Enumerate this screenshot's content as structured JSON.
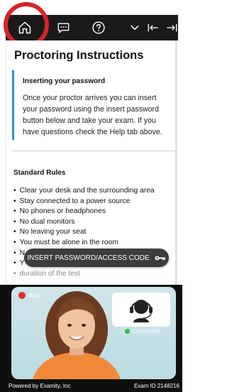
{
  "toolbar": {
    "icons": [
      "home-icon",
      "chat-icon",
      "help-icon",
      "chevron-down-icon",
      "collapse-left-icon",
      "collapse-right-icon"
    ]
  },
  "page": {
    "title": "Proctoring Instructions"
  },
  "notice": {
    "title": "Inserting your password",
    "body": "Once your proctor arrives you can insert your password using the insert password button below and take your exam. If you have questions check the Help tab above."
  },
  "rules": {
    "heading": "Standard Rules",
    "items": [
      "Clear your desk and the surrounding area",
      "Stay connected to a power source",
      "No phones or headphones",
      "No dual monitors",
      "No leaving your seat",
      "You must be alone in the room",
      "N",
      "Y",
      "duration of the test"
    ]
  },
  "action": {
    "insert_label": "INSERT PASSWORD/ACCESS CODE"
  },
  "video": {
    "rec_label": "Rec",
    "connected_label": "Connected"
  },
  "footer": {
    "powered_by": "Powered by Examity, Inc",
    "exam_id": "Exam ID 2148216"
  },
  "colors": {
    "toolbar": "#1a1a1a",
    "highlight_ring": "#d8242a",
    "notice_border": "#2a8fd1",
    "rec": "#e32b2b",
    "connected": "#27c24a"
  }
}
